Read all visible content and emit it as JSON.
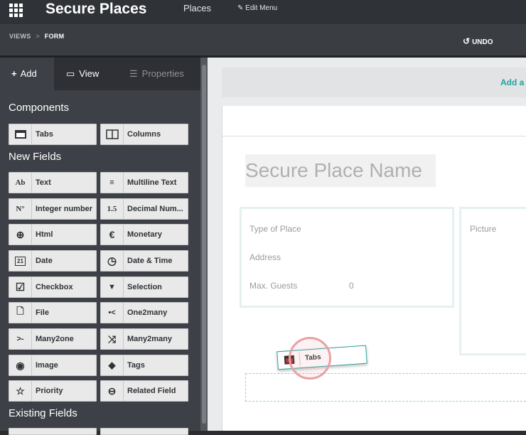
{
  "topbar": {
    "title": "Secure Places",
    "menu_places": "Places",
    "edit_menu": "Edit Menu"
  },
  "subbar": {
    "crumb_views": "VIEWS",
    "crumb_sep": ">",
    "crumb_form": "FORM",
    "undo": "UNDO"
  },
  "sidebar": {
    "tabs": {
      "add": "Add",
      "view": "View",
      "properties": "Properties"
    },
    "components_heading": "Components",
    "components": [
      {
        "label": "Tabs",
        "icon": "tabs-icon"
      },
      {
        "label": "Columns",
        "icon": "columns-icon"
      }
    ],
    "new_fields_heading": "New Fields",
    "new_fields": [
      {
        "label": "Text",
        "icon_text": "Ab"
      },
      {
        "label": "Multiline Text",
        "icon_text": "≡"
      },
      {
        "label": "Integer number",
        "icon_text": "N°"
      },
      {
        "label": "Decimal Num...",
        "icon_text": "1.5"
      },
      {
        "label": "Html",
        "icon_text": "⊕"
      },
      {
        "label": "Monetary",
        "icon_text": "€"
      },
      {
        "label": "Date",
        "icon_text": "21"
      },
      {
        "label": "Date & Time",
        "icon_text": "◷"
      },
      {
        "label": "Checkbox",
        "icon_text": "☑"
      },
      {
        "label": "Selection",
        "icon_text": "▼"
      },
      {
        "label": "File",
        "icon_text": "🗋"
      },
      {
        "label": "One2many",
        "icon_text": "•<"
      },
      {
        "label": "Many2one",
        "icon_text": ">-"
      },
      {
        "label": "Many2many",
        "icon_text": "⤨"
      },
      {
        "label": "Image",
        "icon_text": "◉"
      },
      {
        "label": "Tags",
        "icon_text": "◆"
      },
      {
        "label": "Priority",
        "icon_text": "☆"
      },
      {
        "label": "Related Field",
        "icon_text": "⊖"
      }
    ],
    "existing_fields_heading": "Existing Fields"
  },
  "main": {
    "add_link": "Add a",
    "place_name_placeholder": "Secure Place Name",
    "fields": {
      "type_of_place": "Type of Place",
      "address": "Address",
      "max_guests": "Max. Guests",
      "max_guests_value": "0",
      "picture": "Picture"
    },
    "drag_label": "Tabs"
  },
  "colors": {
    "accent": "#22a39f",
    "topbar": "#2f3237",
    "sidebar": "#3d4046"
  }
}
